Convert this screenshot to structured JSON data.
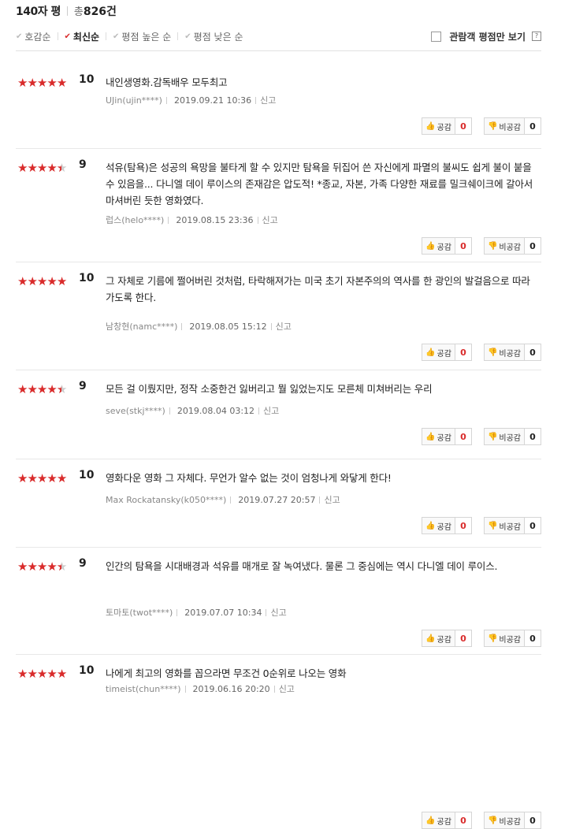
{
  "header": {
    "title": "140자 평",
    "total_prefix": "총",
    "total_count": "826건"
  },
  "sorts": [
    {
      "label": "호감순",
      "active": false
    },
    {
      "label": "최신순",
      "active": true
    },
    {
      "label": "평점 높은 순",
      "active": false
    },
    {
      "label": "평점 낮은 순",
      "active": false
    }
  ],
  "viewer_only_label": "관람객 평점만 보기",
  "help_label": "?",
  "buttons": {
    "like": "공감",
    "dislike": "비공감",
    "report": "신고"
  },
  "reviews": [
    {
      "rating": 10,
      "score": "10",
      "text": "내인생영화.감독배우 모두최고",
      "user": "UJin(ujin****)",
      "date": "2019.09.21 10:36",
      "likes": "0",
      "dislikes": "0"
    },
    {
      "rating": 9,
      "score": "9",
      "text": "석유(탐욕)은 성공의 욕망을 불타게 할 수 있지만 탐욕을 뒤집어 쓴 자신에게 파멸의 불씨도 쉽게 불이 붙을 수 있음을... 다니엘 데이 루이스의 존재감은 압도적! *종교, 자본, 가족 다양한 재료를 밀크쉐이크에 갈아서 마셔버린 듯한 영화였다.",
      "user": "럽스(helo****)",
      "date": "2019.08.15 23:36",
      "likes": "0",
      "dislikes": "0"
    },
    {
      "rating": 10,
      "score": "10",
      "text": "그 자체로 기름에 쩔어버린 것처럼, 타락해져가는 미국 초기 자본주의의 역사를 한 광인의 발걸음으로 따라가도록 한다.",
      "user": "남창현(namc****)",
      "date": "2019.08.05 15:12",
      "likes": "0",
      "dislikes": "0"
    },
    {
      "rating": 9,
      "score": "9",
      "text": "모든 걸 이뤘지만, 정작 소중한건 잃버리고 뭘 잃었는지도 모른체 미쳐버리는 우리",
      "user": "seve(stkj****)",
      "date": "2019.08.04 03:12",
      "likes": "0",
      "dislikes": "0"
    },
    {
      "rating": 10,
      "score": "10",
      "text": "영화다운 영화 그 자체다. 무언가 알수 없는 것이 엄청나게 와닿게 한다!",
      "user": "Max Rockatansky(k050****)",
      "date": "2019.07.27 20:57",
      "likes": "0",
      "dislikes": "0"
    },
    {
      "rating": 9,
      "score": "9",
      "text": "인간의 탐욕을 시대배경과 석유를 매개로 잘 녹여냈다. 물론 그 중심에는 역시 다니엘 데이 루이스.",
      "user": "토마토(twot****)",
      "date": "2019.07.07 10:34",
      "likes": "0",
      "dislikes": "0"
    },
    {
      "rating": 10,
      "score": "10",
      "text": "나에게 최고의 영화를 꼽으라면 무조건 0순위로 나오는 영화",
      "user": "timeist(chun****)",
      "date": "2019.06.16 20:20",
      "likes": "0",
      "dislikes": "0"
    }
  ]
}
